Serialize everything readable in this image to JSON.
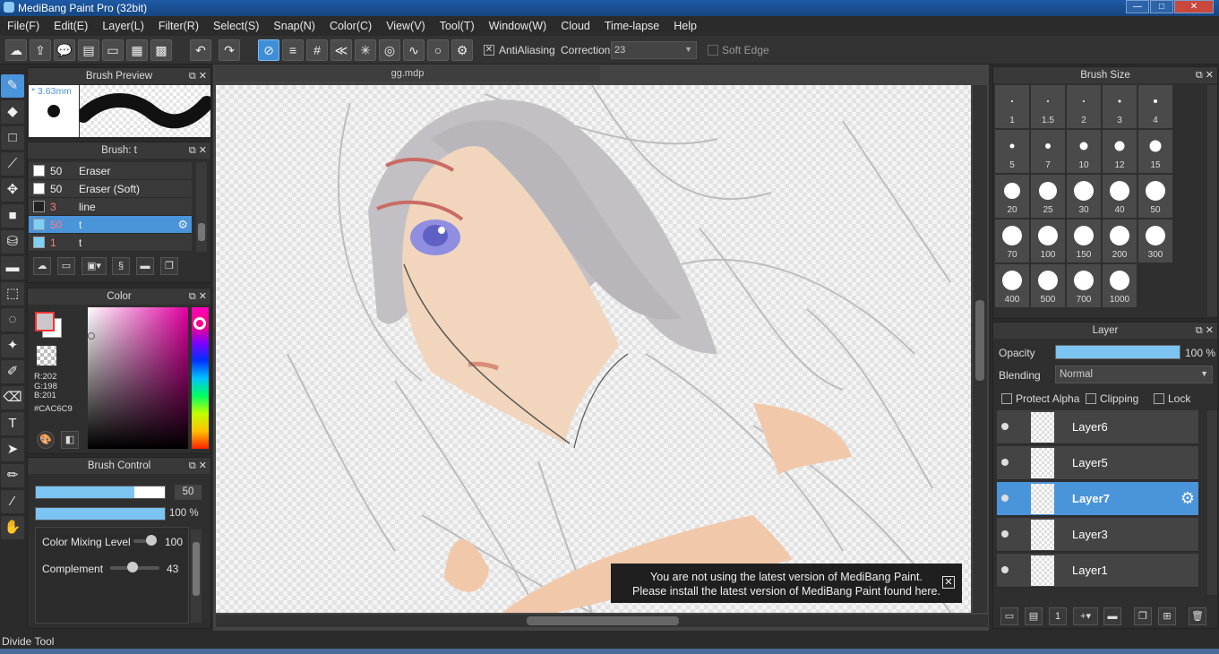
{
  "window": {
    "title": "MediBang Paint Pro (32bit)",
    "min": "—",
    "max": "□",
    "close": "✕"
  },
  "menu": [
    "File(F)",
    "Edit(E)",
    "Layer(L)",
    "Filter(R)",
    "Select(S)",
    "Snap(N)",
    "Color(C)",
    "View(V)",
    "Tool(T)",
    "Window(W)",
    "Cloud",
    "Time-lapse",
    "Help"
  ],
  "toolbar": {
    "antialiasing_label": "AntiAliasing",
    "correction_label": "Correction",
    "correction_value": "23",
    "soft_edge_label": "Soft Edge"
  },
  "brush_preview": {
    "title": "Brush Preview",
    "size": "* 3.63mm"
  },
  "brush_panel": {
    "title": "Brush: t",
    "items": [
      {
        "size": "50",
        "name": "Eraser",
        "color": "#ffffff",
        "selected": false,
        "red": false
      },
      {
        "size": "50",
        "name": "Eraser (Soft)",
        "color": "#ffffff",
        "selected": false,
        "red": false
      },
      {
        "size": "3",
        "name": "line",
        "color": "#222222",
        "selected": false,
        "red": true
      },
      {
        "size": "50",
        "name": "t",
        "color": "#7fd0f5",
        "selected": true,
        "red": true
      },
      {
        "size": "1",
        "name": "t",
        "color": "#7fd0f5",
        "selected": false,
        "red": true
      }
    ]
  },
  "color_panel": {
    "title": "Color",
    "r": "R:202",
    "g": "G:198",
    "b": "B:201",
    "hex": "#CAC6C9",
    "fg": "#CAC6C9",
    "bg": "#ffffff"
  },
  "brush_control": {
    "title": "Brush Control",
    "size_value": "50",
    "opacity_value": "100 %",
    "mixing_label": "Color Mixing Level",
    "mixing_value": "100",
    "complement_label": "Complement",
    "complement_value": "43"
  },
  "document": {
    "tab": "gg.mdp"
  },
  "notice": {
    "line1": "You are not using the latest version of MediBang Paint.",
    "line2": "Please install the latest version of MediBang Paint found here."
  },
  "brush_size": {
    "title": "Brush Size",
    "sizes": [
      "1",
      "1.5",
      "2",
      "3",
      "4",
      "5",
      "7",
      "10",
      "12",
      "15",
      "20",
      "25",
      "30",
      "40",
      "50",
      "70",
      "100",
      "150",
      "200",
      "300",
      "400",
      "500",
      "700",
      "1000"
    ]
  },
  "layer_panel": {
    "title": "Layer",
    "opacity_label": "Opacity",
    "opacity_value": "100 %",
    "blending_label": "Blending",
    "blending_value": "Normal",
    "protect_alpha": "Protect Alpha",
    "clipping": "Clipping",
    "lock": "Lock",
    "layers": [
      {
        "name": "Layer6",
        "selected": false
      },
      {
        "name": "Layer5",
        "selected": false
      },
      {
        "name": "Layer7",
        "selected": true
      },
      {
        "name": "Layer3",
        "selected": false
      },
      {
        "name": "Layer1",
        "selected": false
      }
    ]
  },
  "status": {
    "text": "Divide Tool"
  }
}
